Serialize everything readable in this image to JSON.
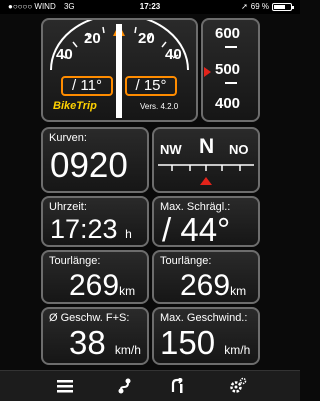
{
  "status": {
    "signal": "●○○○○",
    "carrier": "WIND",
    "network": "3G",
    "time": "17:23",
    "battery": "69 %",
    "battery_level": 0.69
  },
  "lean": {
    "left": "/ 11°",
    "right": "/ 15°",
    "ticks_left": [
      "40",
      "20"
    ],
    "ticks_right": [
      "20",
      "40"
    ],
    "logo": "BikeTrip",
    "version": "Vers. 4.2.0"
  },
  "altitude": {
    "top": "600",
    "mid": "500",
    "bottom": "400"
  },
  "kurven": {
    "label": "Kurven:",
    "value": "0920"
  },
  "compass": {
    "left": "NW",
    "center": "N",
    "right": "NO"
  },
  "uhrzeit": {
    "label": "Uhrzeit:",
    "value": "17:23",
    "unit": "h"
  },
  "max_schraeg": {
    "label": "Max. Schrägl.:",
    "value": "/ 44°"
  },
  "tourlaenge1": {
    "label": "Tourlänge:",
    "value": "269",
    "unit": "km"
  },
  "tourlaenge2": {
    "label": "Tourlänge:",
    "value": "269",
    "unit": "km"
  },
  "avg_speed": {
    "label": "Ø Geschw. F+S:",
    "value": "38",
    "unit": "km/h"
  },
  "max_speed": {
    "label": "Max. Geschwind.:",
    "value": "150",
    "unit": "km/h"
  },
  "tabs": [
    "menu-icon",
    "route-icon",
    "navigation-icon",
    "settings-icon"
  ],
  "colors": {
    "accent": "#ff8c00",
    "red": "#e2231a",
    "yellow": "#ffd200",
    "frame": "#6d6d6d"
  }
}
